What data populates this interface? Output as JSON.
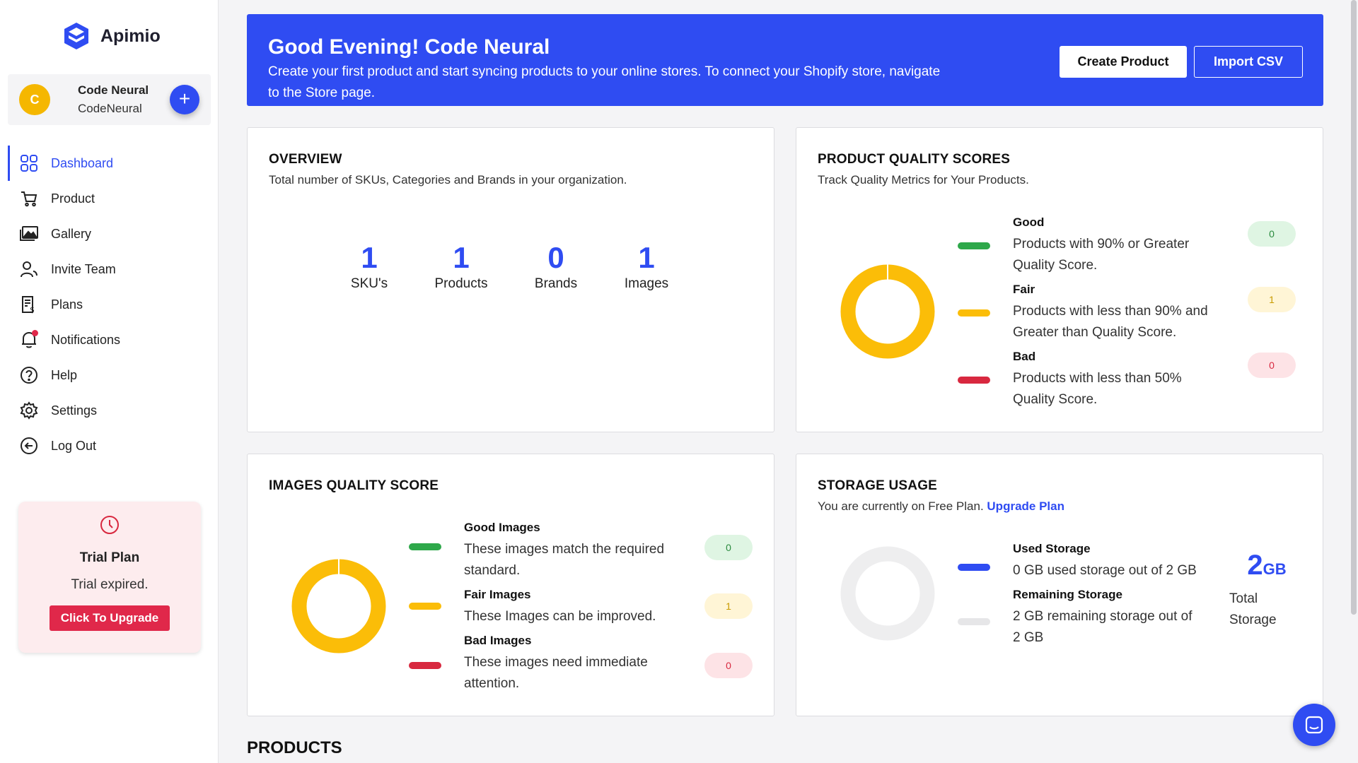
{
  "app": {
    "name": "Apimio"
  },
  "user": {
    "initial": "C",
    "name": "Code Neural",
    "org": "CodeNeural",
    "add_label": "+"
  },
  "nav": {
    "items": [
      {
        "label": "Dashboard",
        "icon": "dashboard-icon"
      },
      {
        "label": "Product",
        "icon": "cart-icon"
      },
      {
        "label": "Gallery",
        "icon": "gallery-icon"
      },
      {
        "label": "Invite Team",
        "icon": "invite-team-icon"
      },
      {
        "label": "Plans",
        "icon": "plans-icon"
      },
      {
        "label": "Notifications",
        "icon": "bell-icon"
      },
      {
        "label": "Help",
        "icon": "help-icon"
      },
      {
        "label": "Settings",
        "icon": "gear-icon"
      },
      {
        "label": "Log Out",
        "icon": "logout-icon"
      }
    ],
    "active": "Dashboard"
  },
  "trial": {
    "title": "Trial Plan",
    "subtitle": "Trial expired.",
    "button": "Click To Upgrade"
  },
  "banner": {
    "greeting": "Good Evening! Code Neural",
    "message": "Create your first product and start syncing products to your online stores. To connect your Shopify store, navigate to the Store page.",
    "create_button": "Create Product",
    "import_button": "Import CSV"
  },
  "overview": {
    "title": "OVERVIEW",
    "subtitle": "Total number of SKUs, Categories and Brands in your organization.",
    "stats": [
      {
        "value": "1",
        "label": "SKU's"
      },
      {
        "value": "1",
        "label": "Products"
      },
      {
        "value": "0",
        "label": "Brands"
      },
      {
        "value": "1",
        "label": "Images"
      }
    ]
  },
  "product_quality": {
    "title": "PRODUCT QUALITY SCORES",
    "subtitle": "Track Quality Metrics for Your Products.",
    "items": [
      {
        "head": "Good",
        "text1": "Products with 90% or Greater",
        "text2": "Quality Score.",
        "count": "0"
      },
      {
        "head": "Fair",
        "text1": "Products with less than 90% and",
        "text2": "Greater than Quality Score.",
        "count": "1"
      },
      {
        "head": "Bad",
        "text1": "Products with less than 50%",
        "text2": "Quality Score.",
        "count": "0"
      }
    ]
  },
  "images_quality": {
    "title": "IMAGES QUALITY SCORE",
    "items": [
      {
        "head": "Good Images",
        "text1": "These images match the required",
        "text2": "standard.",
        "count": "0"
      },
      {
        "head": "Fair Images",
        "text1": "These Images can be improved.",
        "text2": "",
        "count": "1"
      },
      {
        "head": "Bad Images",
        "text1": "These images need immediate",
        "text2": "attention.",
        "count": "0"
      }
    ]
  },
  "storage": {
    "title": "STORAGE USAGE",
    "subtitle": "You are currently on Free Plan.",
    "upgrade_link": "Upgrade Plan",
    "used_head": "Used Storage",
    "used_text": "0 GB used storage out of 2 GB",
    "remaining_head": "Remaining Storage",
    "remaining_text1": "2 GB remaining storage out of",
    "remaining_text2": "2 GB",
    "total_value": "2",
    "total_unit": "GB",
    "total_label1": "Total",
    "total_label2": "Storage"
  },
  "products_heading": "PRODUCTS",
  "colors": {
    "primary": "#2f4cf2",
    "good": "#2ea84a",
    "fair": "#fbbd08",
    "bad": "#d8283f",
    "remaining": "#e6e6e8"
  }
}
